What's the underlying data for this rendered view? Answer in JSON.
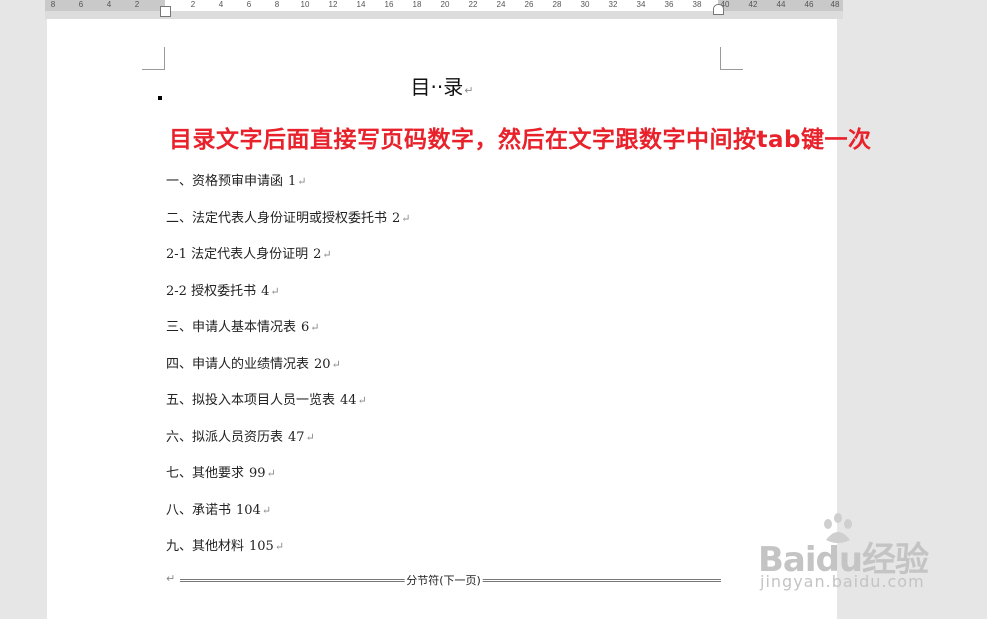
{
  "ruler": {
    "ticks": [
      "8",
      "6",
      "4",
      "2",
      "2",
      "4",
      "6",
      "8",
      "10",
      "12",
      "14",
      "16",
      "18",
      "20",
      "22",
      "24",
      "26",
      "28",
      "30",
      "32",
      "34",
      "36",
      "38",
      "40",
      "42",
      "44",
      "46",
      "48"
    ]
  },
  "document": {
    "title": "目··录",
    "paragraph_mark": "↵",
    "instruction": "目录文字后面直接写页码数字，然后在文字跟数字中间按tab键一次",
    "toc": [
      {
        "text": "一、资格预审申请函",
        "page": "1"
      },
      {
        "text": "二、法定代表人身份证明或授权委托书",
        "page": "2"
      },
      {
        "text": "2-1 法定代表人身份证明",
        "page": "2"
      },
      {
        "text": "2-2 授权委托书",
        "page": "4"
      },
      {
        "text": "三、申请人基本情况表",
        "page": "6"
      },
      {
        "text": "四、申请人的业绩情况表",
        "page": "20"
      },
      {
        "text": "五、拟投入本项目人员一览表",
        "page": "44"
      },
      {
        "text": "六、拟派人员资历表",
        "page": "47"
      },
      {
        "text": "七、其他要求",
        "page": "99"
      },
      {
        "text": "八、承诺书",
        "page": "104"
      },
      {
        "text": "九、其他材料",
        "page": "105"
      }
    ],
    "section_break_label": "分节符(下一页)"
  },
  "watermark": {
    "brand": "Baidu经验",
    "sub": "jingyan.baidu.com"
  }
}
